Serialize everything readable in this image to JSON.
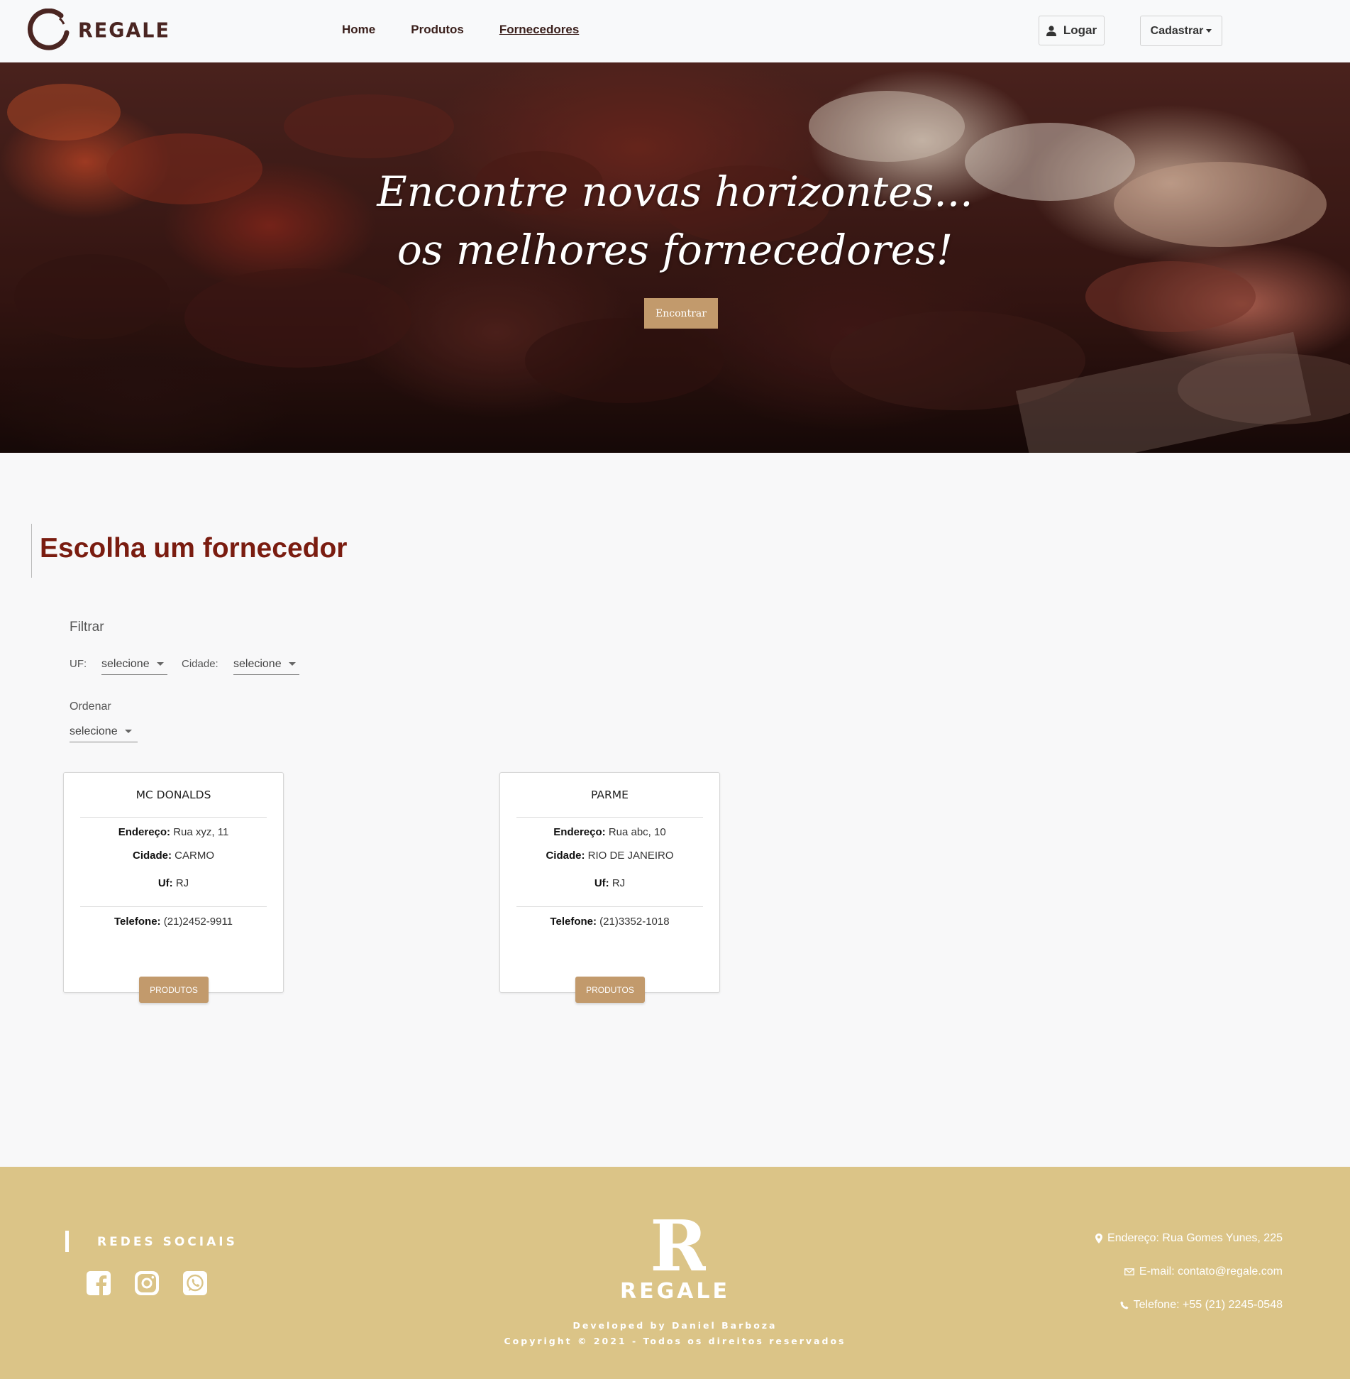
{
  "navbar": {
    "brand": "REGALE",
    "links": [
      {
        "label": "Home"
      },
      {
        "label": "Produtos"
      },
      {
        "label": "Fornecedores"
      }
    ],
    "login_label": "Logar",
    "register_label": "Cadastrar"
  },
  "hero": {
    "title_line1": "Encontre novas horizontes...",
    "title_line2": "os melhores fornecedores!",
    "button_label": "Encontrar"
  },
  "section": {
    "title_prefix": "Escolha um",
    "title_bold": "fornecedor"
  },
  "filters": {
    "filter_label": "Filtrar",
    "uf_label": "UF:",
    "uf_value": "selecione",
    "city_label": "Cidade:",
    "city_value": "selecione",
    "order_label": "Ordenar",
    "order_value": "selecione"
  },
  "suppliers": [
    {
      "name": "MC DONALDS",
      "address_label": "Endereço:",
      "address": "Rua xyz, 11",
      "city_label": "Cidade:",
      "city": "CARMO",
      "uf_label": "Uf:",
      "uf": "RJ",
      "phone_label": "Telefone:",
      "phone": "(21)2452-9911",
      "button_label": "PRODUTOS"
    },
    {
      "name": "PARME",
      "address_label": "Endereço:",
      "address": "Rua abc, 10",
      "city_label": "Cidade:",
      "city": "RIO DE JANEIRO",
      "uf_label": "Uf:",
      "uf": "RJ",
      "phone_label": "Telefone:",
      "phone": "(21)3352-1018",
      "button_label": "PRODUTOS"
    }
  ],
  "footer": {
    "social_title": "REDES SOCIAIS",
    "social_icons": [
      "facebook-icon",
      "instagram-icon",
      "whatsapp-icon"
    ],
    "brand_letter": "R",
    "brand": "REGALE",
    "developed_by": "Developed by Daniel Barboza",
    "copyright": "Copyright © 2021 - Todos os direitos reservados",
    "address": "Endereço: Rua Gomes Yunes, 225",
    "email": "E-mail: contato@regale.com",
    "phone": "Telefone: +55 (21) 2245-0548"
  },
  "colors": {
    "brand_dark": "#4a2521",
    "accent": "#c29a6c",
    "title_red": "#7a1c10",
    "footer_bg": "#dbc487"
  }
}
